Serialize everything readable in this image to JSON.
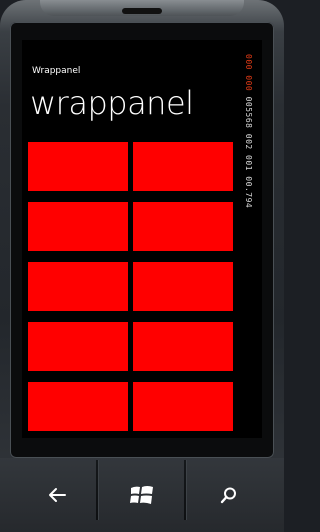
{
  "app": {
    "title": "Wrappanel"
  },
  "page": {
    "title": "wrappanel"
  },
  "counter": {
    "line1": "000",
    "line2": "000",
    "line3": "005568 002 001 00.794"
  },
  "tiles": {
    "count": 10,
    "color": "#ff0000"
  },
  "nav": {
    "back": {
      "icon": "back-arrow-icon"
    },
    "start": {
      "icon": "windows-logo-icon"
    },
    "search": {
      "icon": "search-icon"
    }
  }
}
